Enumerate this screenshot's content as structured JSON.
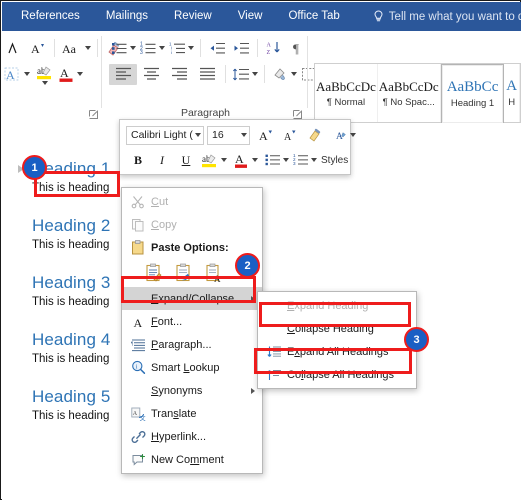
{
  "ribbon": {
    "tabs": [
      {
        "label": "References"
      },
      {
        "label": "Mailings"
      },
      {
        "label": "Review"
      },
      {
        "label": "View"
      },
      {
        "label": "Office Tab"
      }
    ],
    "tellme": {
      "placeholder": "Tell me what you want to do...",
      "icon": "lightbulb-icon"
    },
    "accent_color": "#2b579a",
    "groups": [
      {
        "name": "font",
        "label": ""
      },
      {
        "name": "paragraph",
        "label": "Paragraph"
      },
      {
        "name": "styles",
        "label": ""
      }
    ],
    "styles_gallery": [
      {
        "preview": "AaBbCcDc",
        "name": "¶ Normal",
        "active": false
      },
      {
        "preview": "AaBbCcDc",
        "name": "¶ No Spac...",
        "active": false
      },
      {
        "preview": "AaBbCc",
        "name": "Heading 1",
        "active": true
      },
      {
        "preview": "A",
        "name": "H",
        "active": false
      }
    ]
  },
  "mini_toolbar": {
    "font_name": "Calibri Light (",
    "font_size": "16",
    "bold": "B",
    "italic": "I",
    "underline": "U",
    "styles_label": "Styles"
  },
  "document": {
    "paragraphs": [
      {
        "heading": "Heading 1",
        "body": "This is heading"
      },
      {
        "heading": "Heading 2",
        "body": "This is heading"
      },
      {
        "heading": "Heading 3",
        "body": "This is heading"
      },
      {
        "heading": "Heading 4",
        "body": "This is heading"
      },
      {
        "heading": "Heading 5",
        "body": "This is heading"
      }
    ],
    "heading_color": "#2e74b5"
  },
  "context_menu": {
    "items": [
      {
        "label": "Cut",
        "icon": "scissors-icon",
        "disabled": true
      },
      {
        "label": "Copy",
        "icon": "copy-icon",
        "disabled": true
      },
      {
        "label": "Paste Options:",
        "icon": "paste-icon",
        "disabled": false
      },
      {
        "label": "Expand/Collapse",
        "icon": "none",
        "disabled": false,
        "submenu": true,
        "highlighted": true
      },
      {
        "label": "Font...",
        "icon": "font-a-icon",
        "disabled": false
      },
      {
        "label": "Paragraph...",
        "icon": "paragraph-icon",
        "disabled": false
      },
      {
        "label": "Smart Lookup",
        "icon": "magnifier-icon",
        "disabled": false
      },
      {
        "label": "Synonyms",
        "icon": "none",
        "disabled": false,
        "submenu": true
      },
      {
        "label": "Translate",
        "icon": "translate-icon",
        "disabled": false
      },
      {
        "label": "Hyperlink...",
        "icon": "link-icon",
        "disabled": false
      },
      {
        "label": "New Comment",
        "icon": "comment-icon",
        "disabled": false
      }
    ],
    "paste_options": [
      {
        "name": "keep-source-formatting"
      },
      {
        "name": "merge-formatting"
      },
      {
        "name": "keep-text-only"
      }
    ]
  },
  "submenu": {
    "items": [
      {
        "label": "Expand Heading",
        "disabled": true,
        "icon": "none"
      },
      {
        "label": "Collapse Heading",
        "disabled": false,
        "icon": "none"
      },
      {
        "label": "Expand All Headings",
        "disabled": false,
        "icon": "expand-all-icon"
      },
      {
        "label": "Collapse All Headings",
        "disabled": false,
        "icon": "collapse-all-icon"
      }
    ]
  },
  "annotations": {
    "badges": [
      {
        "number": "1"
      },
      {
        "number": "2"
      },
      {
        "number": "3"
      }
    ],
    "highlight_color": "#ee1c1c",
    "badge_color": "#1a5fc4"
  }
}
